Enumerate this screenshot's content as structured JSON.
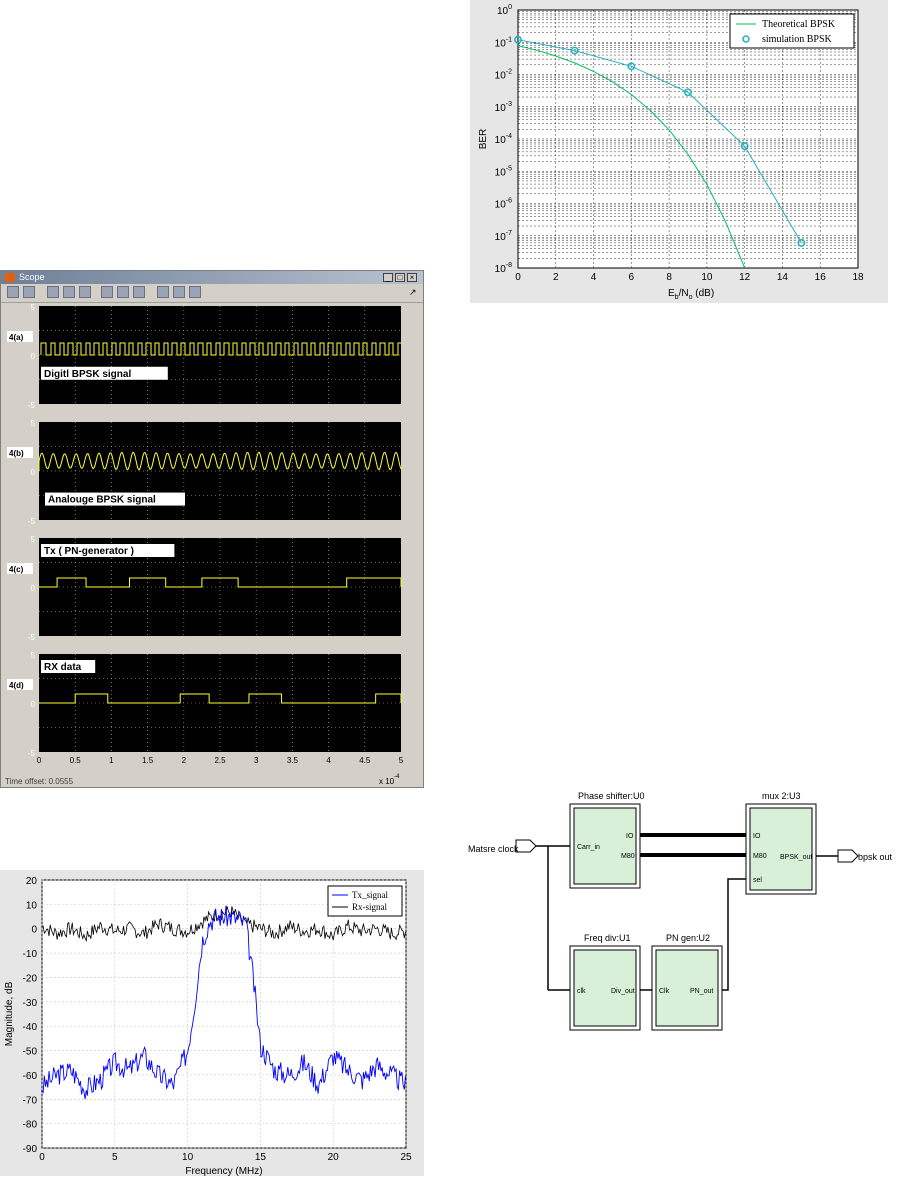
{
  "ber_chart": {
    "chart_data": {
      "type": "line",
      "xlabel": "Eb/No (dB)",
      "ylabel": "BER",
      "xlim": [
        0,
        18
      ],
      "ylim_log10": [
        -8,
        0
      ],
      "x_ticks": [
        "0",
        "2",
        "4",
        "6",
        "8",
        "10",
        "12",
        "14",
        "16",
        "18"
      ],
      "y_ticks": [
        "10^0",
        "10^-1",
        "10^-2",
        "10^-3",
        "10^-4",
        "10^-5",
        "10^-6",
        "10^-7",
        "10^-8"
      ],
      "grid": true,
      "legend": "top-right",
      "series": [
        {
          "name": "Theoretical BPSK",
          "color": "#00c060",
          "x": [
            0,
            1,
            2,
            3,
            4,
            5,
            6,
            7,
            8,
            9,
            10,
            11,
            12
          ],
          "y": [
            0.0786,
            0.0563,
            0.0375,
            0.0229,
            0.0125,
            0.00596,
            0.00239,
            0.000773,
            0.000191,
            3.36e-05,
            3.87e-06,
            2.61e-07,
            9.01e-09
          ]
        },
        {
          "name": "simulation BPSK",
          "color": "#20b0c0",
          "x": [
            0,
            3,
            6,
            9,
            12,
            15
          ],
          "y": [
            0.12,
            0.055,
            0.018,
            0.0028,
            6e-05,
            6e-08
          ]
        }
      ]
    },
    "legend_labels": [
      "Theoretical BPSK",
      "simulation BPSK"
    ],
    "xlabel_main": "E",
    "xlabel_sub1": "b",
    "xlabel_mid": "/N",
    "xlabel_sub2": "o",
    "xlabel_end": " (dB)",
    "ylabel": "BER"
  },
  "scope": {
    "title": "Scope",
    "time_offset": "Time offset:  0.0555",
    "x_exponent": "x 10",
    "x_exponent_power": "-4",
    "x_ticks": [
      "0",
      "0.5",
      "1",
      "1.5",
      "2",
      "2.5",
      "3",
      "3.5",
      "4",
      "4.5",
      "5"
    ],
    "panels": [
      {
        "id": "4(a)",
        "signal": "Digitl BPSK signal",
        "y_ticks": [
          "5",
          "0",
          "-5"
        ]
      },
      {
        "id": "4(b)",
        "signal": "Analouge BPSK signal",
        "y_ticks": [
          "5",
          "0",
          "-5"
        ]
      },
      {
        "id": "4(c)",
        "signal": "Tx ( PN-generator )",
        "y_ticks": [
          "5",
          "0",
          "-5"
        ]
      },
      {
        "id": "4(d)",
        "signal": "RX data",
        "y_ticks": [
          "5",
          "0",
          "-5"
        ]
      }
    ],
    "colors": {
      "trace": "#ffff30",
      "background": "#000000",
      "grid": "#c0c0c0"
    }
  },
  "spectrum_chart": {
    "chart_data": {
      "type": "line",
      "xlabel": "Frequency (MHz)",
      "ylabel": "Magnitude, dB",
      "xlim": [
        0,
        25
      ],
      "ylim": [
        -90,
        20
      ],
      "x_ticks": [
        "0",
        "5",
        "10",
        "15",
        "20",
        "25"
      ],
      "y_ticks": [
        "20",
        "10",
        "0",
        "-10",
        "-20",
        "-30",
        "-40",
        "-50",
        "-60",
        "-70",
        "-80",
        "-90"
      ],
      "grid": true,
      "legend": "top-right",
      "series": [
        {
          "name": "Tx_signal",
          "color": "#0000ff",
          "x": [
            0,
            1,
            2,
            3,
            4,
            5,
            6,
            7,
            8,
            9,
            10,
            10.5,
            11,
            11.5,
            12,
            13,
            14,
            14.5,
            15,
            16,
            17,
            18,
            19,
            20,
            21,
            22,
            23,
            24,
            25
          ],
          "y": [
            -65,
            -60,
            -58,
            -66,
            -62,
            -55,
            -58,
            -52,
            -60,
            -64,
            -50,
            -30,
            -5,
            3,
            5,
            5,
            2,
            -20,
            -48,
            -58,
            -60,
            -55,
            -64,
            -52,
            -58,
            -62,
            -56,
            -60,
            -64
          ]
        },
        {
          "name": "Rx-signal",
          "color": "#000000",
          "x": [
            0,
            1,
            2,
            3,
            4,
            5,
            6,
            7,
            8,
            9,
            10,
            11,
            12,
            13,
            14,
            15,
            16,
            17,
            18,
            19,
            20,
            21,
            22,
            23,
            24,
            25
          ],
          "y": [
            1,
            -2,
            0,
            -3,
            1,
            -1,
            0,
            -2,
            2,
            0,
            -1,
            3,
            6,
            7,
            2,
            0,
            -2,
            1,
            -1,
            0,
            -3,
            1,
            -1,
            0,
            -2,
            -1
          ]
        }
      ]
    },
    "legend_labels": [
      "Tx_signal",
      "Rx-signal"
    ],
    "xlabel": "Frequency (MHz)",
    "ylabel": "Magnitude, dB"
  },
  "block_diagram": {
    "input_label": "Matsre clock",
    "output_label": "bpsk out",
    "blocks": [
      {
        "title": "Phase shifter:U0",
        "ports_left": [
          "Carr_in"
        ],
        "ports_right": [
          "IO",
          "M80"
        ]
      },
      {
        "title": "mux 2:U3",
        "ports_left": [
          "IO",
          "M80",
          "sel"
        ],
        "ports_right": [
          "BPSK_out"
        ]
      },
      {
        "title": "Freq div:U1",
        "ports_left": [
          "clk"
        ],
        "ports_right": [
          "Div_out"
        ]
      },
      {
        "title": "PN gen:U2",
        "ports_left": [
          "Clk"
        ],
        "ports_right": [
          "PN_out"
        ]
      }
    ]
  }
}
